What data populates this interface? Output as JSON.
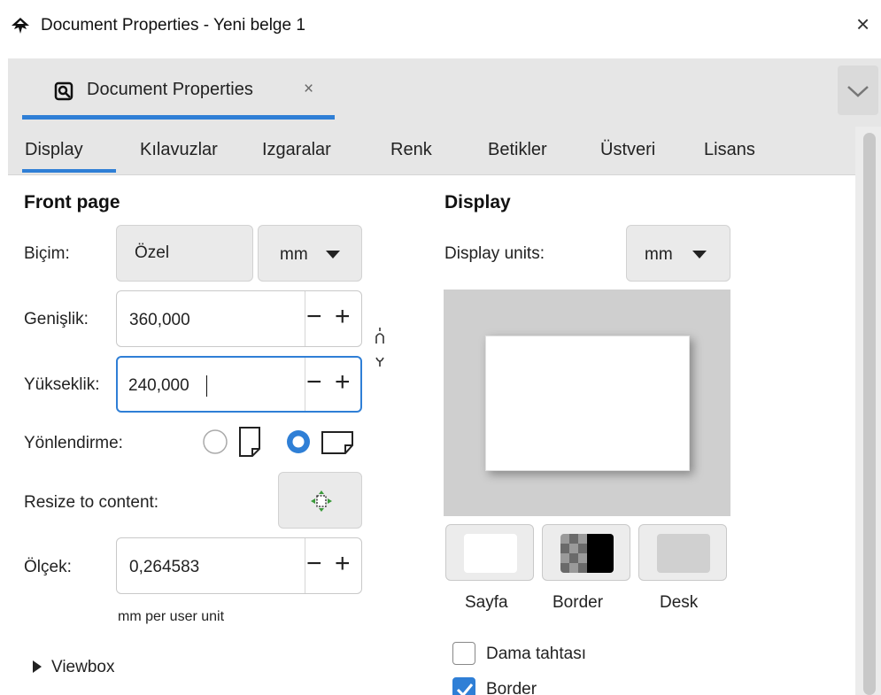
{
  "window": {
    "title": "Document Properties - Yeni belge 1",
    "close_glyph": "×",
    "app_icon": "inkscape-icon"
  },
  "dock": {
    "tab_label": "Document Properties",
    "tab_close": "×",
    "tab_icon": "document-properties-icon",
    "accent_color": "#2f7fd6"
  },
  "tabs": [
    "Display",
    "Kılavuzlar",
    "Izgaralar",
    "Renk",
    "Betikler",
    "Üstveri",
    "Lisans"
  ],
  "front_page": {
    "title": "Front page",
    "format_label": "Biçim:",
    "format_value": "Özel",
    "format_unit": "mm",
    "width_label": "Genişlik:",
    "width_value": "360,000",
    "height_label": "Yükseklik:",
    "height_value": "240,000",
    "orientation_label": "Yönlendirme:",
    "orientation_selected": "landscape",
    "resize_label": "Resize to content:",
    "scale_label": "Ölçek:",
    "scale_value": "0,264583",
    "scale_unit_note": "mm per user unit",
    "viewbox_label": "Viewbox"
  },
  "display": {
    "title": "Display",
    "units_label": "Display units:",
    "units_value": "mm",
    "swatches": [
      {
        "label": "Sayfa",
        "color": "#ffffff"
      },
      {
        "label": "Border",
        "color": "#000000"
      },
      {
        "label": "Desk",
        "color": "#d0d0d0"
      }
    ],
    "checkerboard_label": "Dama tahtası",
    "checkerboard_checked": false,
    "border_label": "Border",
    "border_checked": true
  }
}
